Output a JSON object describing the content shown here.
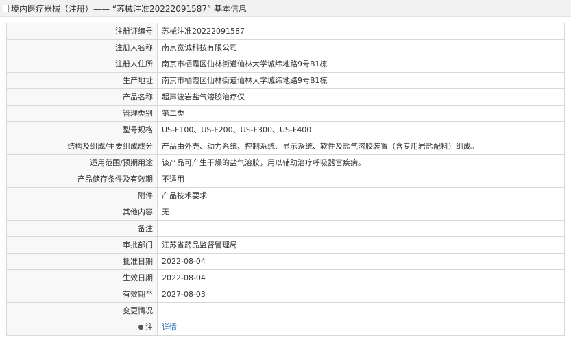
{
  "header": {
    "title": "境内医疗器械（注册）——  “苏械注准20222091587”  基本信息"
  },
  "rows": [
    {
      "label": "注册证编号",
      "value": "苏械注准20222091587"
    },
    {
      "label": "注册人名称",
      "value": "南京宽诚科技有限公司"
    },
    {
      "label": "注册人住所",
      "value": "南京市栖霞区仙林街道仙林大学城纬地路9号B1栋"
    },
    {
      "label": "生产地址",
      "value": "南京市栖霞区仙林街道仙林大学城纬地路9号B1栋"
    },
    {
      "label": "产品名称",
      "value": "超声波岩盐气溶胶治疗仪"
    },
    {
      "label": "管理类别",
      "value": "第二类"
    },
    {
      "label": "型号规格",
      "value": "US-F100、US-F200、US-F300、US-F400"
    },
    {
      "label": "结构及组成/主要组成成分",
      "value": "产品由外壳、动力系统、控制系统、显示系统、软件及盐气溶胶装置（含专用岩盐配料）组成。"
    },
    {
      "label": "适用范围/预期用途",
      "value": "该产品可产生干燥的盐气溶胶，用以辅助治疗呼吸器官疾病。"
    },
    {
      "label": "产品储存条件及有效期",
      "value": "不适用"
    },
    {
      "label": "附件",
      "value": "产品技术要求"
    },
    {
      "label": "其他内容",
      "value": "无"
    },
    {
      "label": "备注",
      "value": ""
    },
    {
      "label": "审批部门",
      "value": "江苏省药品监督管理局"
    },
    {
      "label": "批准日期",
      "value": "2022-08-04"
    },
    {
      "label": "生效日期",
      "value": "2022-08-04"
    },
    {
      "label": "有效期至",
      "value": "2027-08-03"
    },
    {
      "label": "变更情况",
      "value": ""
    }
  ],
  "footer_row": {
    "label": "注",
    "link_text": "详情"
  }
}
